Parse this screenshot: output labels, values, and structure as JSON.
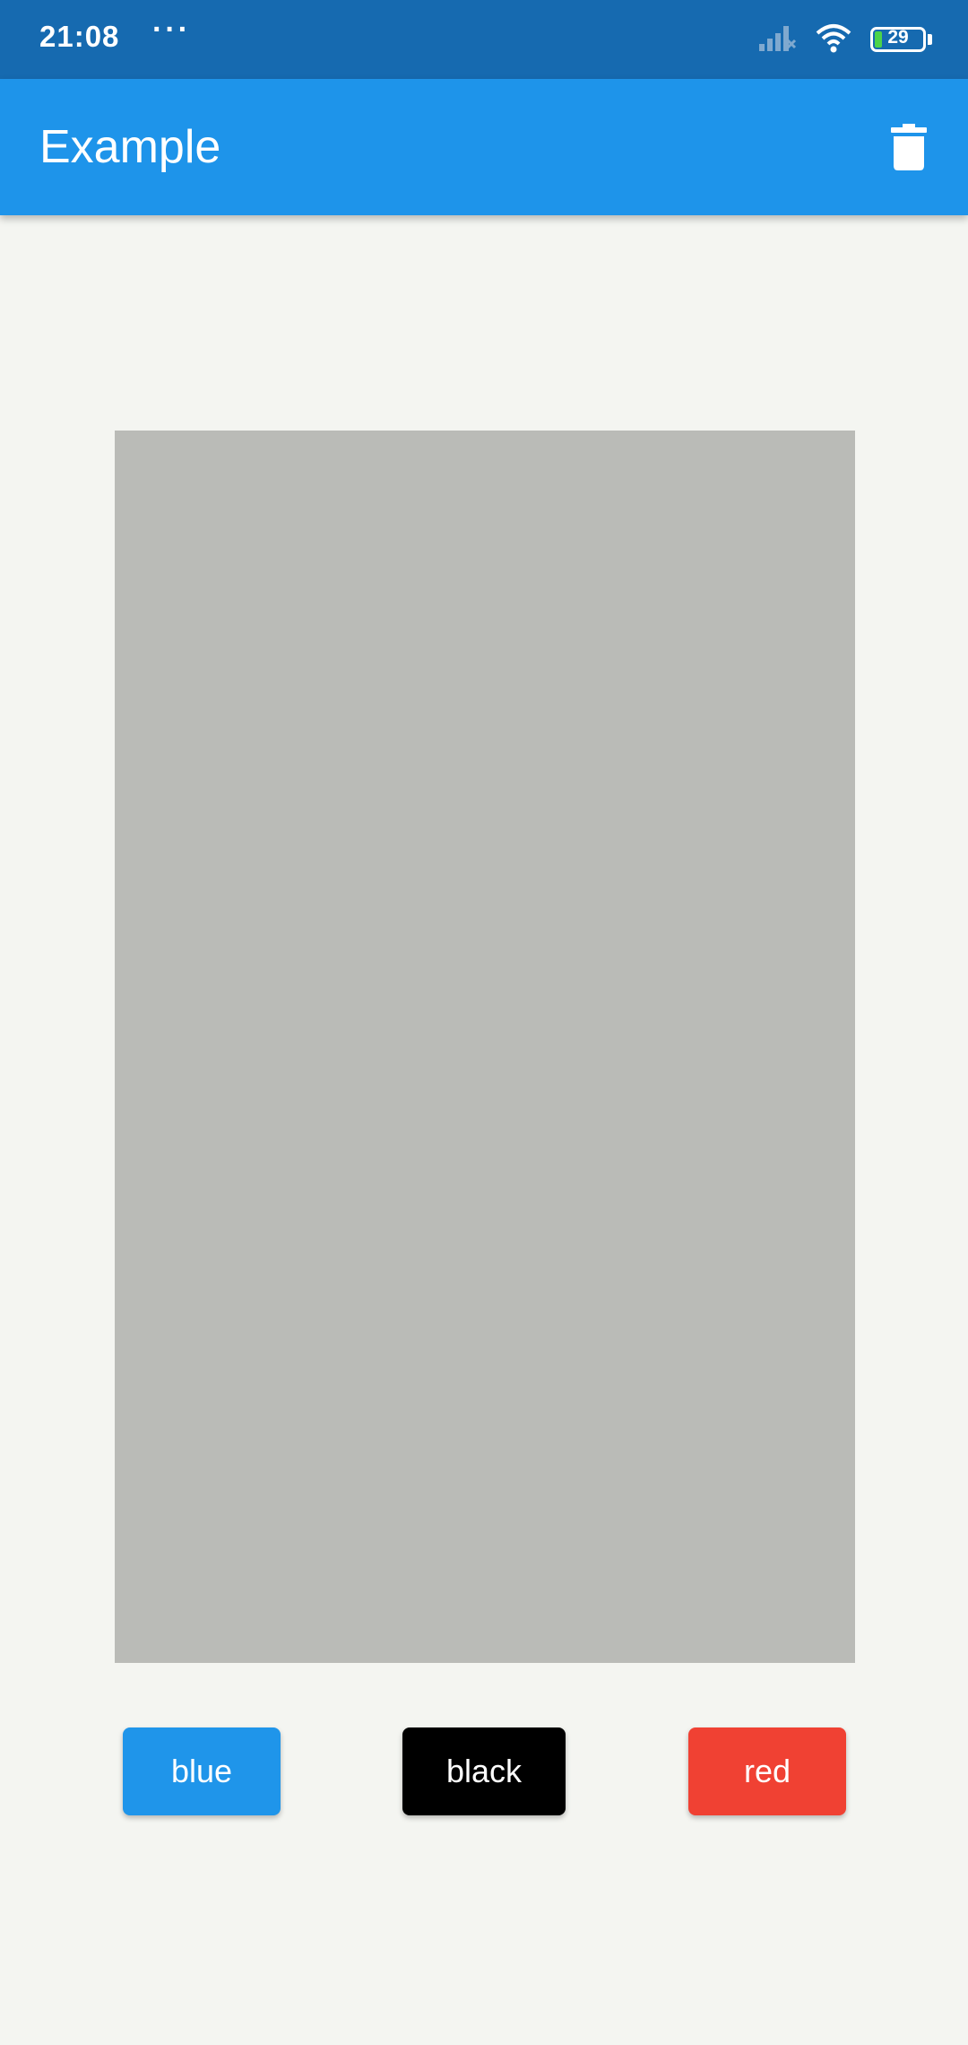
{
  "status_bar": {
    "time": "21:08",
    "dots": "···",
    "battery_level": "29"
  },
  "app_bar": {
    "title": "Example",
    "delete_icon": "trash-icon"
  },
  "colors": {
    "app_bar": "#1e94ea",
    "status_bar": "#166ab0",
    "canvas": "#babbb7",
    "blue": "#1f95ea",
    "black": "#000000",
    "red": "#f04133"
  },
  "buttons": {
    "blue_label": "blue",
    "black_label": "black",
    "red_label": "red"
  }
}
